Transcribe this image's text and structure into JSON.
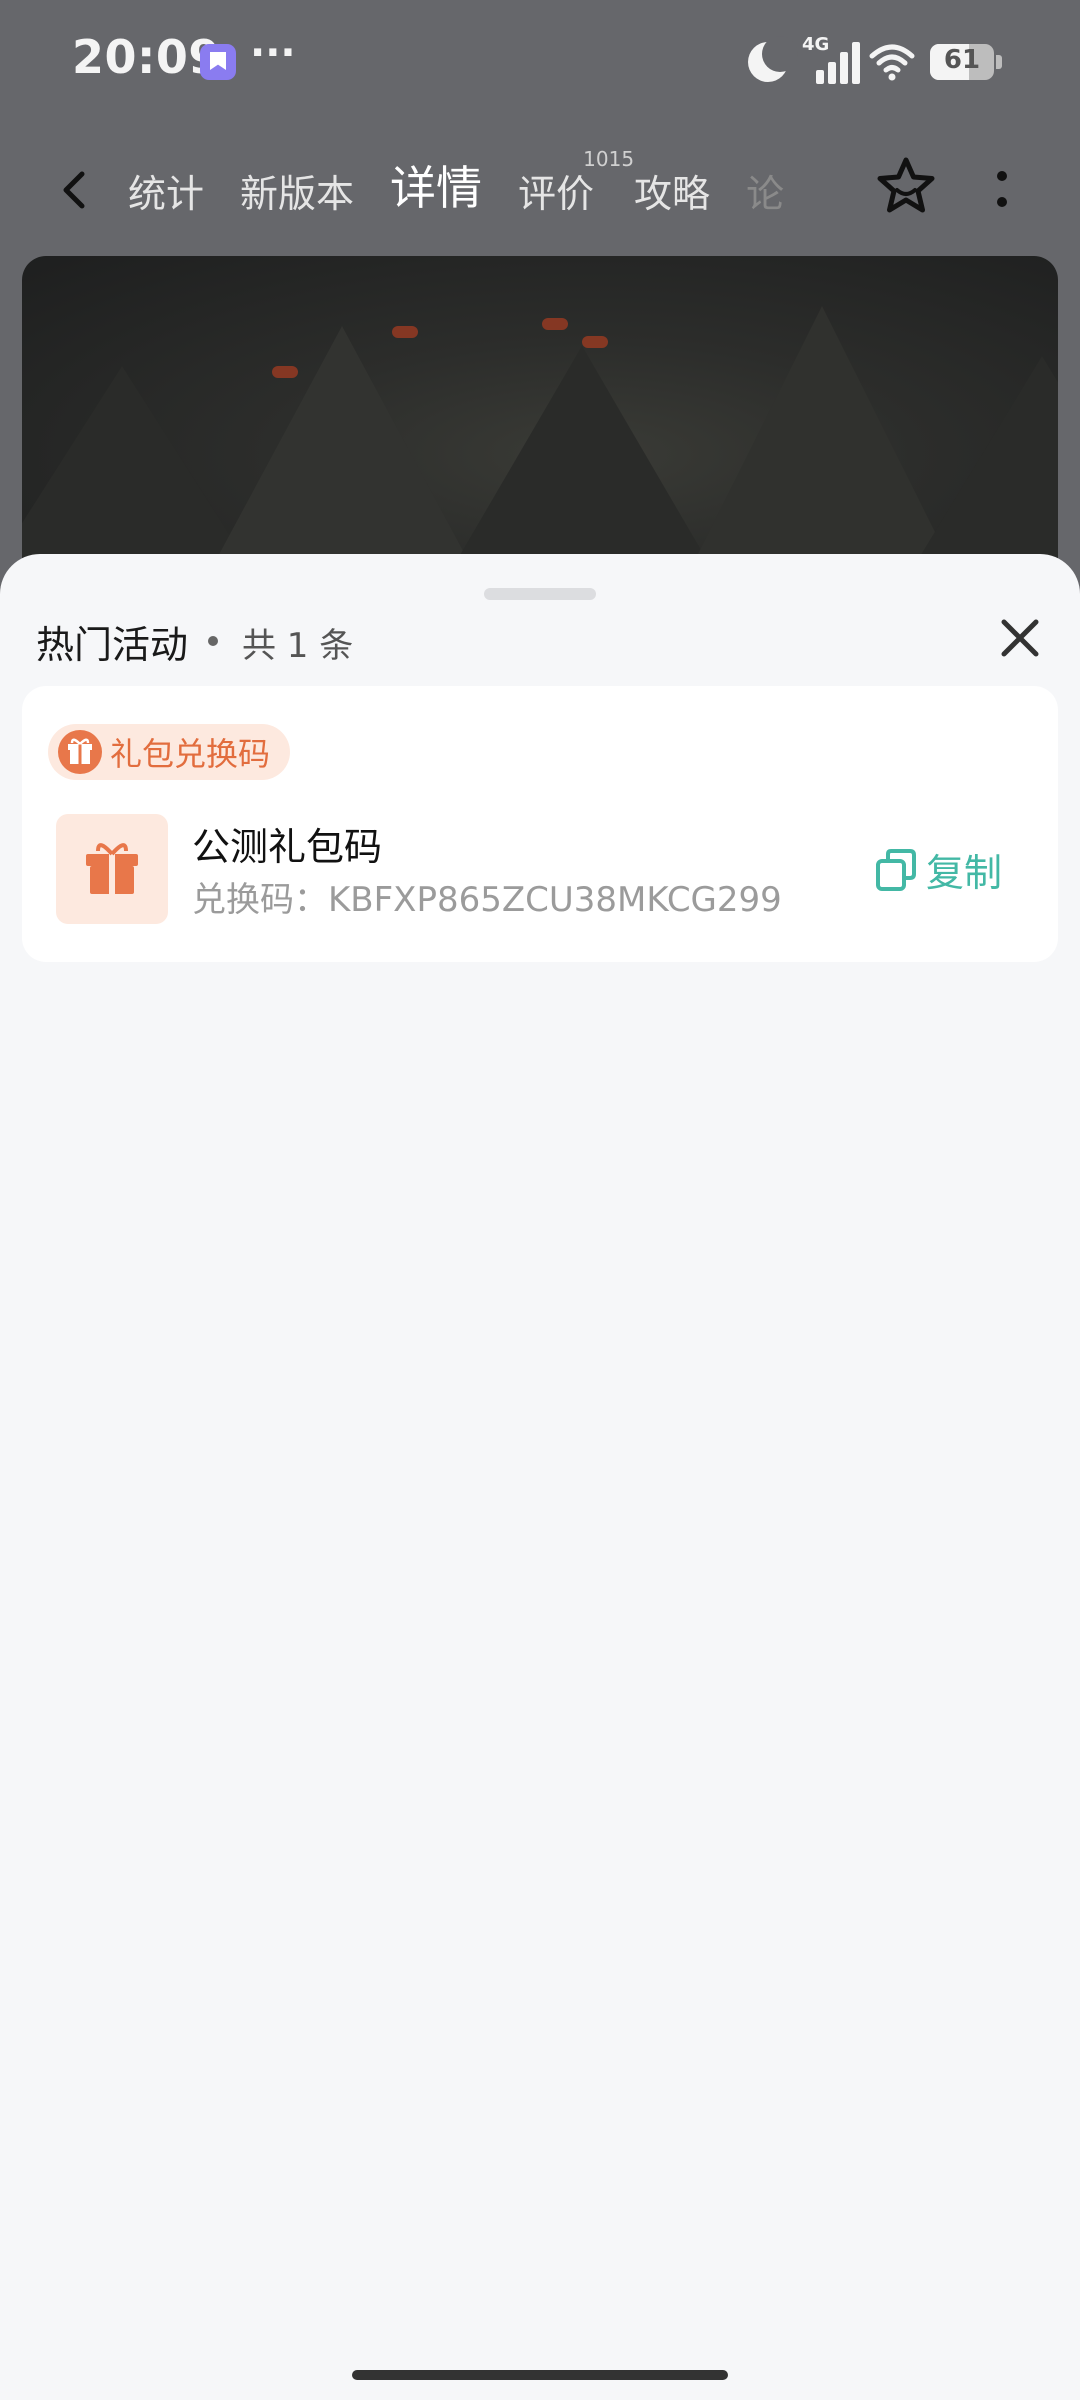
{
  "status_bar": {
    "time": "20:09",
    "more_indicator": "···",
    "network": "4G",
    "battery": "61",
    "icons": [
      "app-notification-icon",
      "moon-icon",
      "signal-icon",
      "wifi-icon",
      "battery-icon"
    ]
  },
  "nav": {
    "back_icon": "chevron-left-icon",
    "tabs": [
      {
        "label": "统计"
      },
      {
        "label": "新版本"
      },
      {
        "label": "详情",
        "active": true
      },
      {
        "label": "评价",
        "superscript": "1015"
      },
      {
        "label": "攻略"
      },
      {
        "label": "论"
      }
    ],
    "favorite_icon": "star-outline-icon",
    "more_icon": "vertical-dots-icon",
    "active_color": "#1f7a66"
  },
  "sheet": {
    "title": "热门活动",
    "count": "共 1 条",
    "close_icon": "close-icon",
    "card": {
      "tag_label": "礼包兑换码",
      "gift_title": "公测礼包码",
      "gift_code": "兑换码：KBFXP865ZCU38MKCG299",
      "copy_label": "复制",
      "accent_color": "#e8774a",
      "copy_color": "#43b8a5"
    }
  }
}
